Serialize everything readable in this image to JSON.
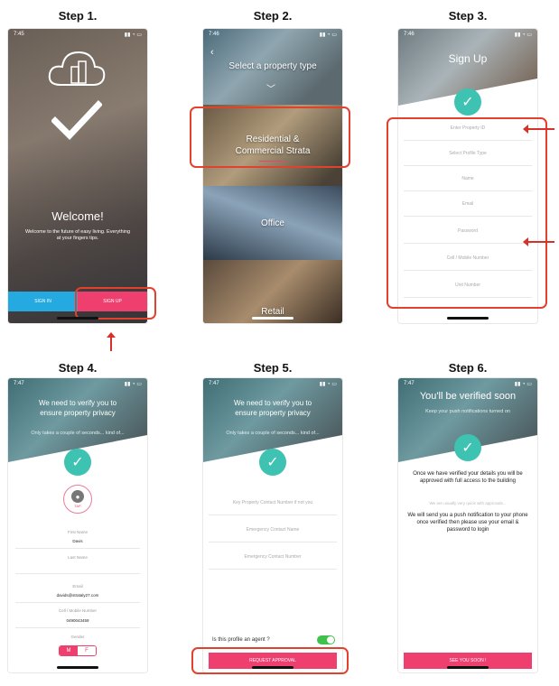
{
  "steps": [
    "Step 1.",
    "Step 2.",
    "Step 3.",
    "Step 4.",
    "Step 5.",
    "Step 6."
  ],
  "screen1": {
    "time": "7:45",
    "welcome": "Welcome!",
    "tagline": "Welcome to the future of easy living. Everything at your fingers tips.",
    "sign_in": "SIGN IN",
    "sign_up": "SIGN UP"
  },
  "screen2": {
    "time": "7:46",
    "title": "Select a property type",
    "options": [
      "Residential & Commercial Strata",
      "Office",
      "Retail"
    ]
  },
  "screen3": {
    "time": "7:46",
    "title": "Sign Up",
    "fields": [
      "Enter Property ID",
      "Select Profile Type",
      "Name",
      "Email",
      "Password",
      "Cell / Mobile Number",
      "Unit Number"
    ]
  },
  "screen4": {
    "time": "7:47",
    "header": "We need to verify you to ensure property privacy",
    "sub": "Only takes a couple of seconds... kind of...",
    "tap": "TAP",
    "first_name_label": "First Name",
    "first_name_value": "Davis",
    "last_name_label": "Last Name",
    "email_label": "Email",
    "email_value": "davids@strataly27.com",
    "cell_label": "Cell / Mobile Number",
    "cell_value": "0490043459",
    "gender_label": "Gender",
    "gender_m": "M",
    "gender_f": "F"
  },
  "screen5": {
    "time": "7:47",
    "header": "We need to verify you to ensure property privacy",
    "sub": "Only takes a couple of seconds... kind of...",
    "fields": [
      "Key Property Contact Number if not you",
      "Emergency Contact Name",
      "Emergency Contact Number"
    ],
    "agent_question": "Is this profile an agent ?",
    "request": "REQUEST APPROVAL"
  },
  "screen6": {
    "time": "7:47",
    "title": "You'll be verified soon",
    "sub": "Keep your push notifications turned on",
    "para1": "Once we have verified your details you will be approved with full access to the building",
    "muted": "We are usually very quick with approvals...",
    "para2": "We will send you a push notification to your phone once verified then please use your email & password to login",
    "button": "SEE YOU SOON !"
  },
  "colors": {
    "pink": "#ef3f6e",
    "blue": "#24a9e1",
    "teal": "#3ec2b2",
    "highlight": "#e2412e"
  }
}
